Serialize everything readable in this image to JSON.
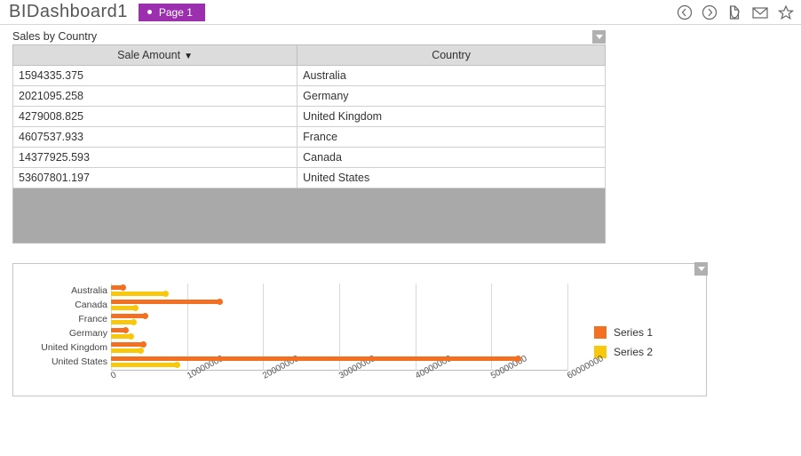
{
  "header": {
    "title": "BIDashboard1",
    "tab_label": "Page 1"
  },
  "table_widget": {
    "title": "Sales by Country",
    "columns": {
      "col0": "Sale Amount",
      "col1": "Country"
    },
    "sort_indicator": "▼",
    "rows": [
      {
        "amount": "1594335.375",
        "country": "Australia"
      },
      {
        "amount": "2021095.258",
        "country": "Germany"
      },
      {
        "amount": "4279008.825",
        "country": "United Kingdom"
      },
      {
        "amount": "4607537.933",
        "country": "France"
      },
      {
        "amount": "14377925.593",
        "country": "Canada"
      },
      {
        "amount": "53607801.197",
        "country": "United States"
      }
    ]
  },
  "chart_data": {
    "type": "bar",
    "orientation": "horizontal",
    "categories": [
      "Australia",
      "Canada",
      "France",
      "Germany",
      "United Kingdom",
      "United States"
    ],
    "series": [
      {
        "name": "Series 1",
        "color": "#f36f21",
        "values": [
          1594335,
          14377926,
          4607538,
          2021095,
          4279009,
          53607801
        ]
      },
      {
        "name": "Series 2",
        "color": "#f7c80b",
        "values": [
          7200000,
          3300000,
          3000000,
          2700000,
          4000000,
          8700000
        ]
      }
    ],
    "xlim": [
      0,
      60000000
    ],
    "x_ticks": [
      0,
      10000000,
      20000000,
      30000000,
      40000000,
      50000000,
      60000000
    ],
    "xlabel": "",
    "ylabel": ""
  },
  "legend": {
    "s1": "Series 1",
    "s2": "Series 2"
  },
  "icons": {
    "back": "back-icon",
    "forward": "forward-icon",
    "pdf": "pdf-icon",
    "mail": "mail-icon",
    "star": "star-icon"
  }
}
